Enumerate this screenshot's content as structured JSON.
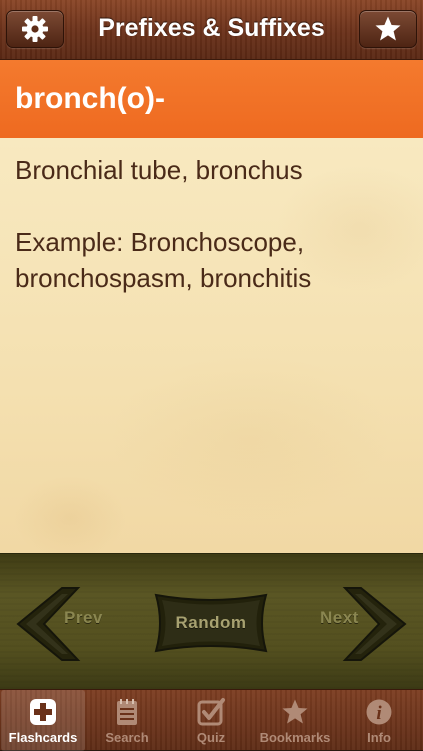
{
  "header": {
    "title": "Prefixes & Suffixes",
    "settings_icon": "gear-icon",
    "bookmark_icon": "star-icon"
  },
  "card": {
    "term": "bronch(o)-",
    "definition": "Bronchial tube, bronchus",
    "example": "Example: Bronchoscope, bronchospasm, bronchitis"
  },
  "nav": {
    "prev_label": "Prev",
    "random_label": "Random",
    "next_label": "Next"
  },
  "tabbar": {
    "tabs": [
      {
        "label": "Flashcards",
        "icon": "plus-cross-icon",
        "active": true
      },
      {
        "label": "Search",
        "icon": "notepad-icon",
        "active": false
      },
      {
        "label": "Quiz",
        "icon": "checkbox-icon",
        "active": false
      },
      {
        "label": "Bookmarks",
        "icon": "star-icon",
        "active": false
      },
      {
        "label": "Info",
        "icon": "info-icon",
        "active": false
      }
    ]
  },
  "colors": {
    "header": "#6a311a",
    "term_bar": "#ee6a20",
    "card": "#f6e4b8",
    "card_text": "#4a2a18",
    "nav_strip": "#54501f",
    "tabbar": "#6a3119"
  }
}
